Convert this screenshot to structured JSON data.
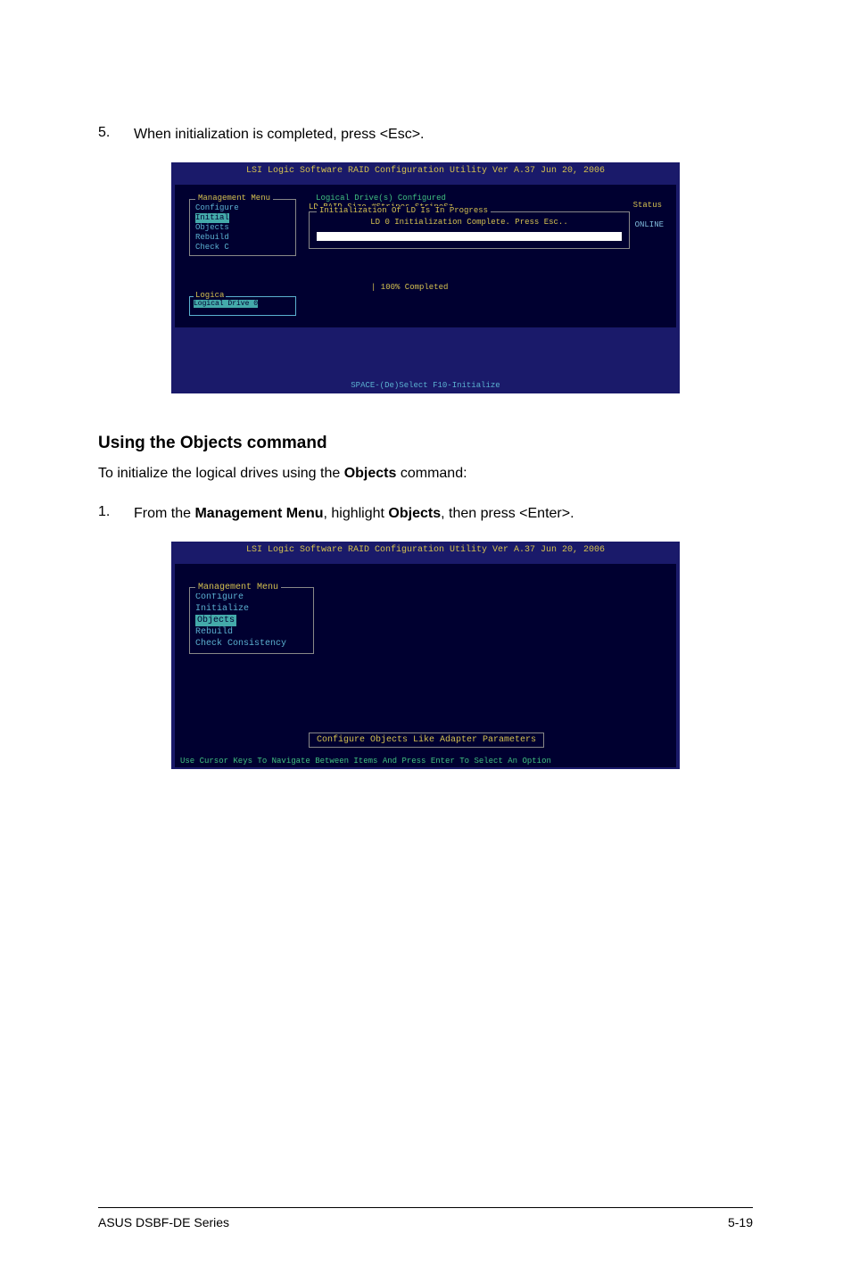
{
  "step5": {
    "num": "5.",
    "text_before": "When initialization is completed, press ",
    "key": "<Esc>",
    "text_after": "."
  },
  "bios1": {
    "title": "LSI Logic Software RAID Configuration Utility Ver A.37 Jun 20, 2006",
    "mgmt_title": "Management Menu",
    "mgmt_items": [
      "Configure",
      "Initial",
      "Objects",
      "Rebuild",
      "Check C"
    ],
    "ld_header_prefix": "Logical Drive(s) Configured",
    "ld_cols": "LD    RAID     Size    #Stripes   StripeSz",
    "status": "Status",
    "online": "ONLINE",
    "init_title": "Initialization Of LD Is In Progress",
    "init_msg": "LD 0 Initialization Complete. Press Esc..",
    "progress": "| 100% Completed",
    "logica_title": "Logica",
    "logica_row": "Logical Drive 0",
    "footer": "SPACE-(De)Select   F10-Initialize"
  },
  "heading": "Using the Objects command",
  "intro": {
    "before": "To initialize the logical drives using the ",
    "bold": "Objects",
    "after": " command:"
  },
  "step1": {
    "num": "1.",
    "t1": "From the ",
    "b1": "Management Menu",
    "t2": ", highlight ",
    "b2": "Objects",
    "t3": ", then press <Enter>."
  },
  "bios2": {
    "title": "LSI Logic Software RAID Configuration Utility Ver A.37 Jun 20, 2006",
    "mgmt_title": "Management Menu",
    "mgmt_items": [
      "Configure",
      "Initialize",
      "Objects",
      "Rebuild",
      "Check Consistency"
    ],
    "desc": "Configure Objects Like Adapter Parameters",
    "footer": "Use Cursor Keys To Navigate Between Items And Press Enter To Select An Option"
  },
  "footer": {
    "left": "ASUS DSBF-DE Series",
    "right": "5-19"
  }
}
